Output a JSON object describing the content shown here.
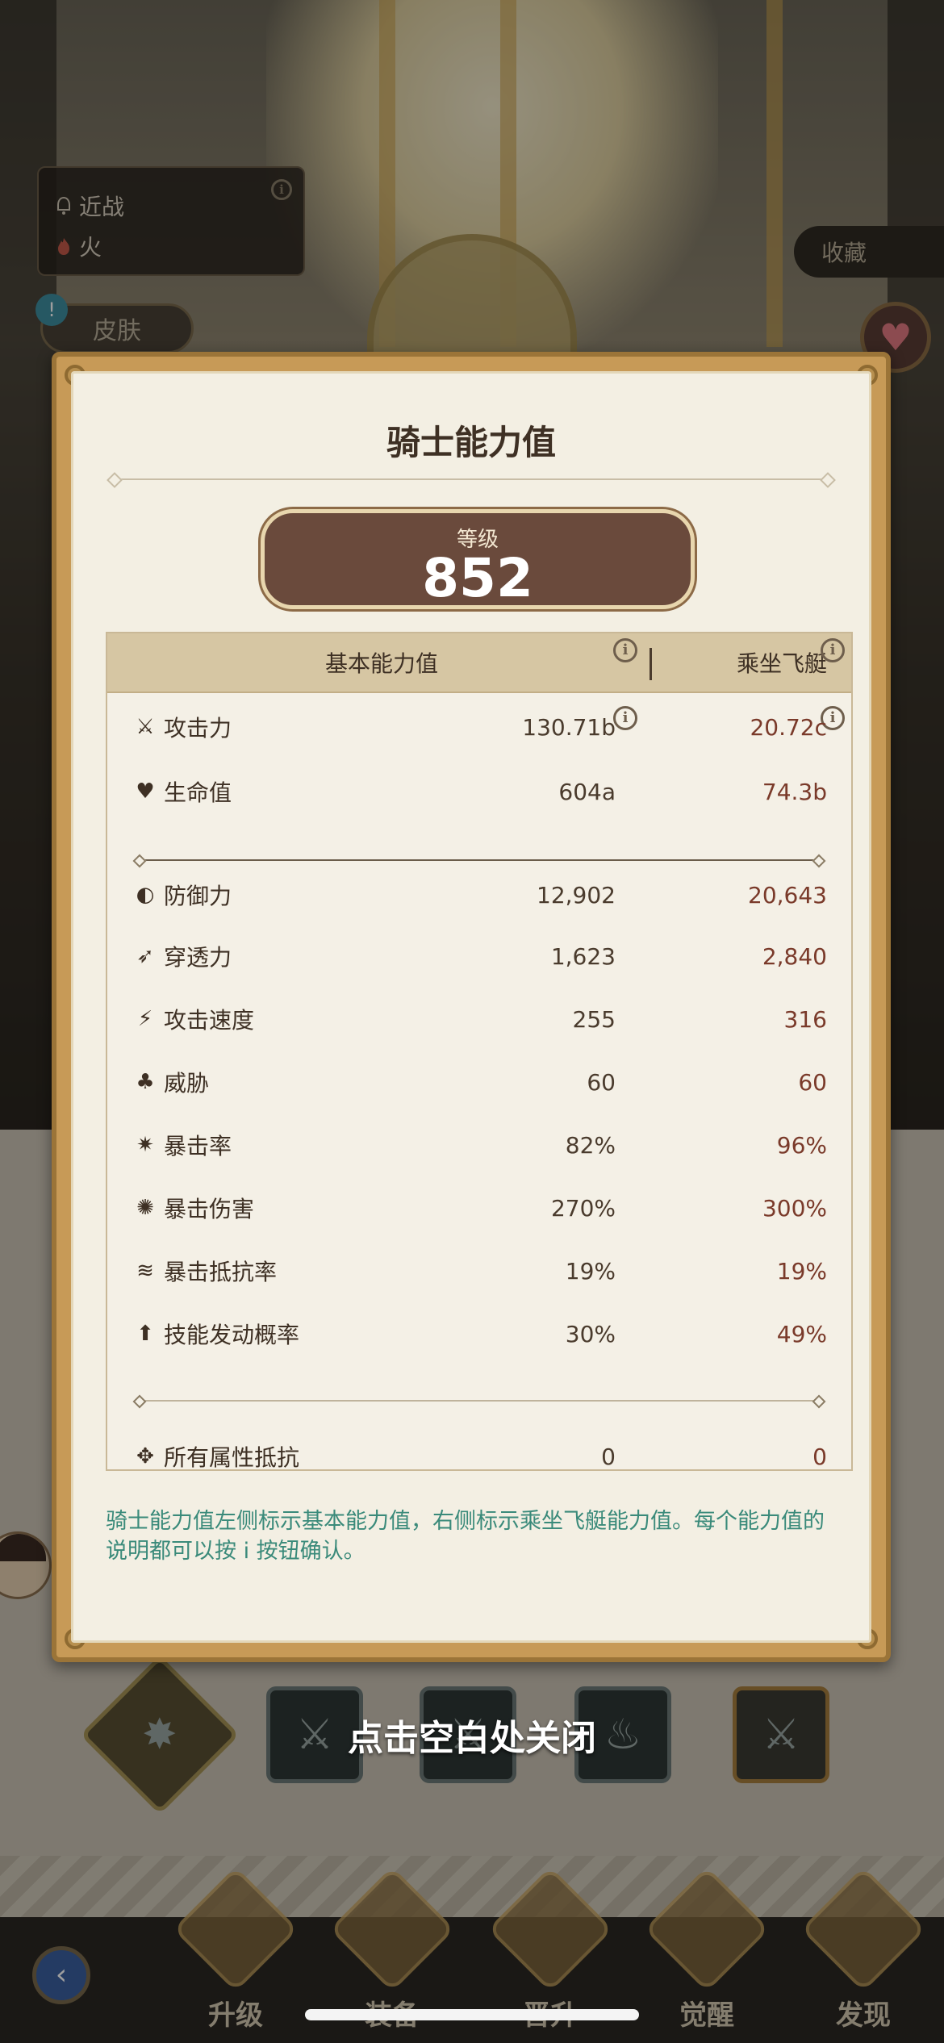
{
  "hero": {
    "type_melee": "近战",
    "element_fire": "火",
    "skin_label": "皮肤",
    "favorite_label": "收藏"
  },
  "modal": {
    "title": "骑士能力值",
    "level_label": "等级",
    "level_value": "852",
    "header_base": "基本能力值",
    "header_mount": "乘坐飞艇",
    "stats": [
      {
        "icon": "sword-icon",
        "name": "攻击力",
        "base": "130.71b",
        "mount": "20.72c"
      },
      {
        "icon": "heart-icon",
        "name": "生命值",
        "base": "604a",
        "mount": "74.3b"
      },
      {
        "icon": "shield-icon",
        "name": "防御力",
        "base": "12,902",
        "mount": "20,643"
      },
      {
        "icon": "pierce-icon",
        "name": "穿透力",
        "base": "1,623",
        "mount": "2,840"
      },
      {
        "icon": "attack-speed-icon",
        "name": "攻击速度",
        "base": "255",
        "mount": "316"
      },
      {
        "icon": "threat-icon",
        "name": "威胁",
        "base": "60",
        "mount": "60"
      },
      {
        "icon": "crit-rate-icon",
        "name": "暴击率",
        "base": "82%",
        "mount": "96%"
      },
      {
        "icon": "crit-damage-icon",
        "name": "暴击伤害",
        "base": "270%",
        "mount": "300%"
      },
      {
        "icon": "crit-resist-icon",
        "name": "暴击抵抗率",
        "base": "19%",
        "mount": "19%"
      },
      {
        "icon": "skill-trigger-icon",
        "name": "技能发动概率",
        "base": "30%",
        "mount": "49%"
      },
      {
        "icon": "all-resist-icon",
        "name": "所有属性抵抗",
        "base": "0",
        "mount": "0"
      }
    ],
    "note": "骑士能力值左侧标示基本能力值，右侧标示乘坐飞艇能力值。每个能力值的说明都可以按 i 按钮确认。"
  },
  "close_hint": "点击空白处关闭",
  "nav": {
    "upgrade": "升级",
    "equipment": "装备",
    "promote": "晋升",
    "awaken": "觉醒",
    "discover": "发现"
  },
  "colors": {
    "accent_teal": "#3a8a7a",
    "mount_value": "#7a3a2a",
    "level_badge": "#6a4a3c"
  }
}
